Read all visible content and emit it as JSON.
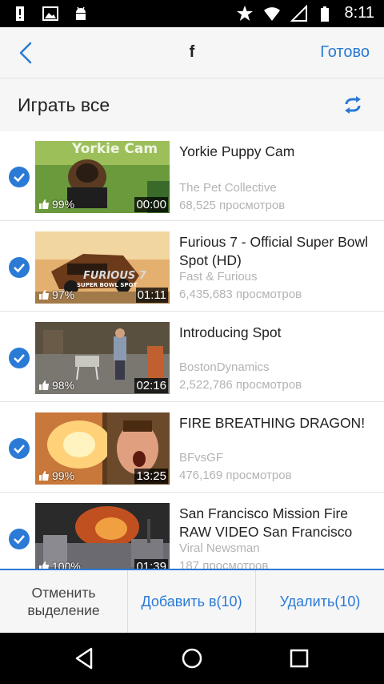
{
  "status_bar": {
    "time": "8:11",
    "left_icons": [
      "alert-icon",
      "image-icon",
      "android-icon"
    ],
    "right_icons": [
      "star-icon",
      "wifi-icon",
      "signal-icon",
      "battery-icon"
    ]
  },
  "app_bar": {
    "title": "f",
    "done_label": "Готово"
  },
  "play_all": {
    "label": "Играть все"
  },
  "videos": [
    {
      "title": "Yorkie Puppy Cam",
      "channel": "The Pet Collective",
      "views": "68,525 просмотров",
      "likes": "99%",
      "duration": "00:00",
      "thumb_text": "Yorkie Cam",
      "selected": true
    },
    {
      "title": "Furious 7 - Official Super Bowl Spot (HD)",
      "channel": "Fast & Furious",
      "views": "6,435,683 просмотров",
      "likes": "97%",
      "duration": "01:11",
      "thumb_text": "FURIOUS 7",
      "thumb_subtext": "SUPER BOWL SPOT",
      "selected": true
    },
    {
      "title": "Introducing Spot",
      "channel": "BostonDynamics",
      "views": "2,522,786 просмотров",
      "likes": "98%",
      "duration": "02:16",
      "selected": true
    },
    {
      "title": "FIRE BREATHING DRAGON!",
      "channel": "BFvsGF",
      "views": "476,169 просмотров",
      "likes": "99%",
      "duration": "13:25",
      "selected": true
    },
    {
      "title": "San Francisco Mission Fire RAW VIDEO San Francisco",
      "channel": "Viral Newsman",
      "views": "187 просмотров",
      "likes": "100%",
      "duration": "01:39",
      "selected": true
    }
  ],
  "actions": {
    "cancel_line1": "Отменить",
    "cancel_line2": "выделение",
    "add_label": "Добавить в(10)",
    "delete_label": "Удалить(10)"
  },
  "colors": {
    "accent": "#2a7ad6",
    "muted_text": "#b3b3b3",
    "bar_background": "#f6f6f6"
  }
}
